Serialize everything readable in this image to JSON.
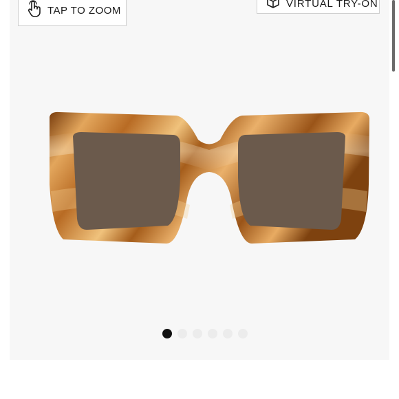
{
  "toolbar": {
    "tap_to_zoom_label": "TAP TO ZOOM",
    "virtual_try_on_label": "VIRTUAL TRY-ON"
  },
  "gallery": {
    "image_alt": "tortoiseshell square sunglasses",
    "slide_count": 6,
    "active_slide": 1
  },
  "icons": {
    "tap": "hand-pointer-icon",
    "try_on": "cube-icon"
  },
  "colors": {
    "tortoise_light": "#e0a35a",
    "tortoise_dark": "#8a4a12",
    "lens": "#6b5a4c",
    "active_dot": "#111111",
    "inactive_dot": "#ececec"
  }
}
